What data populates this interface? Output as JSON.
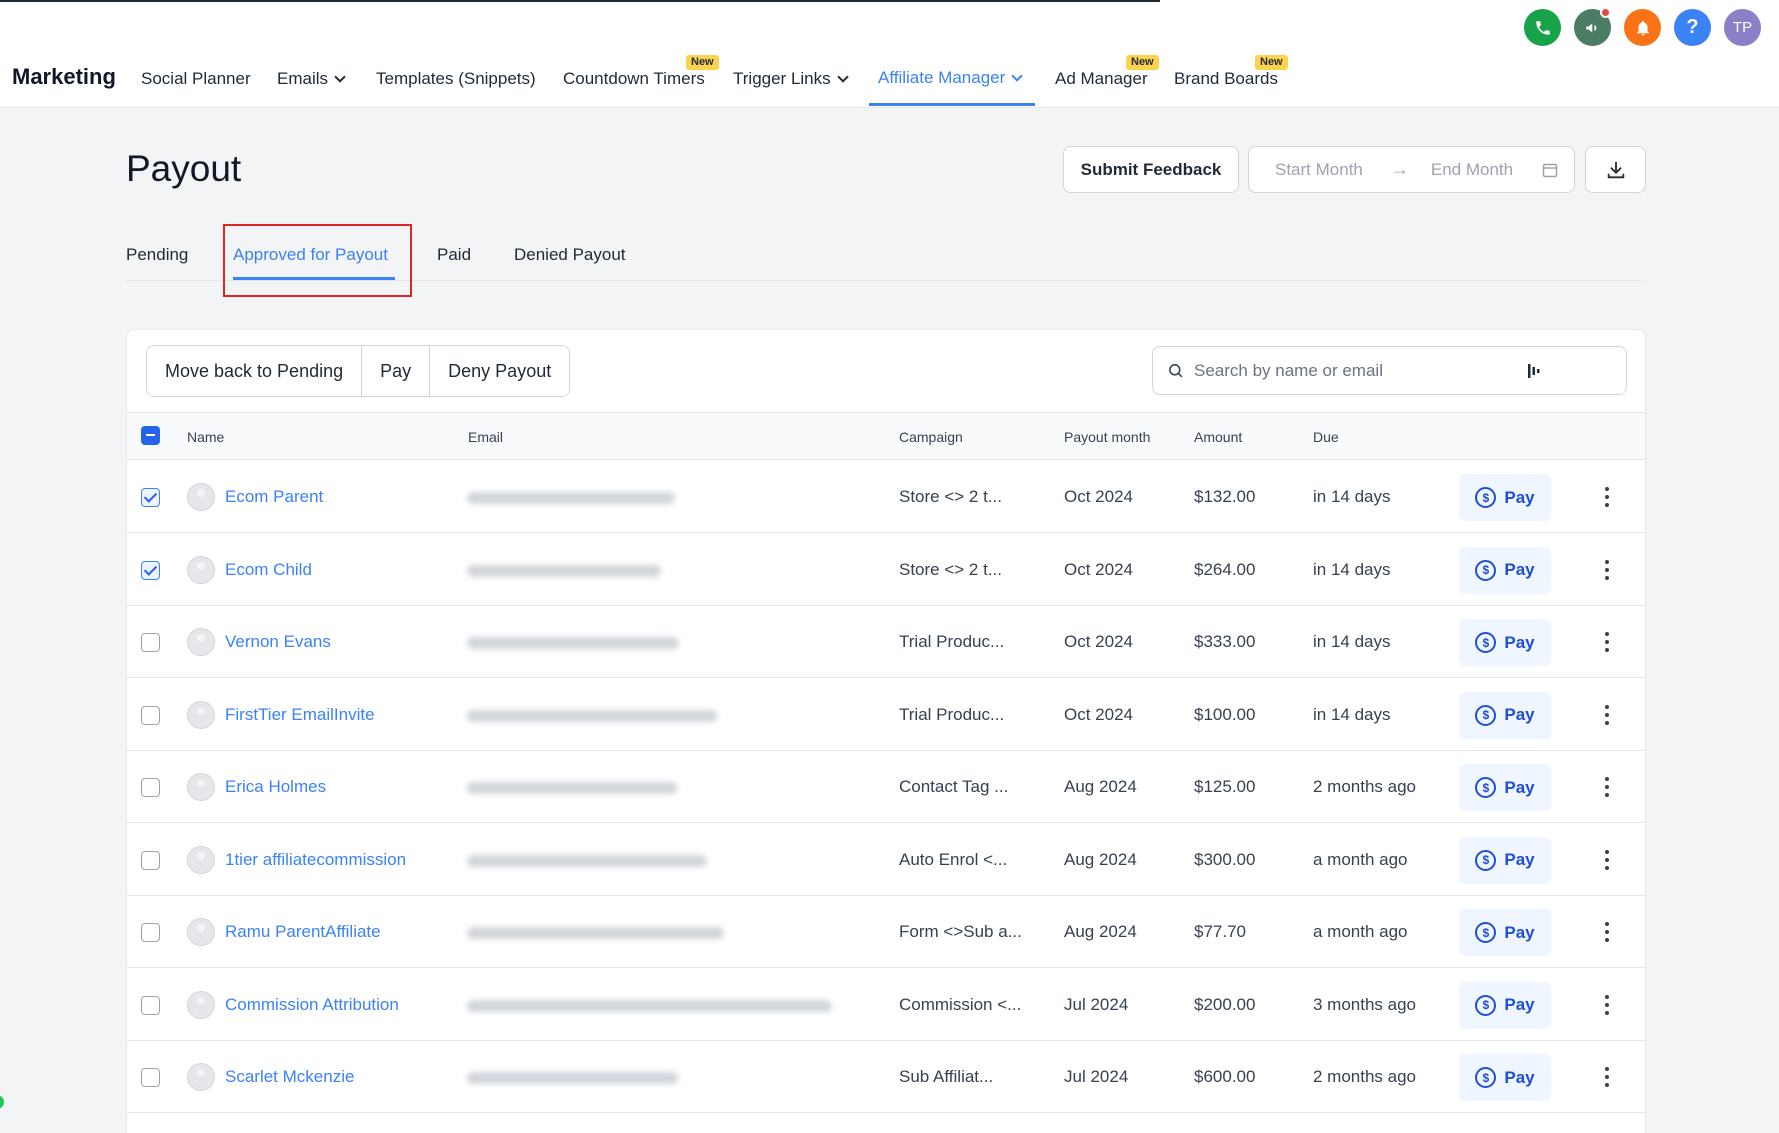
{
  "header": {
    "brand": "Marketing",
    "nav": [
      {
        "label": "Social Planner",
        "dropdown": false,
        "badge": ""
      },
      {
        "label": "Emails",
        "dropdown": true,
        "badge": ""
      },
      {
        "label": "Templates (Snippets)",
        "dropdown": false,
        "badge": ""
      },
      {
        "label": "Countdown Timers",
        "dropdown": false,
        "badge": "New"
      },
      {
        "label": "Trigger Links",
        "dropdown": true,
        "badge": ""
      },
      {
        "label": "Affiliate Manager",
        "dropdown": true,
        "badge": "",
        "active": true
      },
      {
        "label": "Ad Manager",
        "dropdown": false,
        "badge": "New"
      },
      {
        "label": "Brand Boards",
        "dropdown": false,
        "badge": "New"
      }
    ],
    "icons": {
      "phone": {
        "name": "phone-icon",
        "color": "#16a34a"
      },
      "announce": {
        "name": "megaphone-icon",
        "color": "#4a7c66"
      },
      "bell": {
        "name": "bell-icon",
        "color": "#f97316"
      },
      "help": {
        "name": "help-icon",
        "color": "#3b82f6",
        "glyph": "?"
      },
      "user": {
        "initials": "TP",
        "color": "#8b7fc7"
      }
    }
  },
  "page": {
    "title": "Payout",
    "submit_feedback": "Submit Feedback",
    "start_month": "Start Month",
    "end_month": "End Month"
  },
  "tabs": [
    "Pending",
    "Approved for Payout",
    "Paid",
    "Denied Payout"
  ],
  "toolbar": {
    "actions": [
      "Move back to Pending",
      "Pay",
      "Deny Payout"
    ],
    "search_placeholder": "Search by name or email"
  },
  "table": {
    "columns": {
      "name": "Name",
      "email": "Email",
      "campaign": "Campaign",
      "payout_month": "Payout month",
      "amount": "Amount",
      "due": "Due"
    },
    "pay_label": "Pay",
    "rows": [
      {
        "name": "Ecom Parent",
        "campaign": "Store <> 2 t...",
        "month": "Oct 2024",
        "amount": "$132.00",
        "due": "in 14 days",
        "checked": true
      },
      {
        "name": "Ecom Child",
        "campaign": "Store <> 2 t...",
        "month": "Oct 2024",
        "amount": "$264.00",
        "due": "in 14 days",
        "checked": true
      },
      {
        "name": "Vernon Evans",
        "campaign": "Trial Produc...",
        "month": "Oct 2024",
        "amount": "$333.00",
        "due": "in 14 days",
        "checked": false
      },
      {
        "name": "FirstTier EmailInvite",
        "campaign": "Trial Produc...",
        "month": "Oct 2024",
        "amount": "$100.00",
        "due": "in 14 days",
        "checked": false
      },
      {
        "name": "Erica Holmes",
        "campaign": "Contact Tag ...",
        "month": "Aug 2024",
        "amount": "$125.00",
        "due": "2 months ago",
        "checked": false
      },
      {
        "name": "1tier affiliatecommission",
        "campaign": "Auto Enrol <...",
        "month": "Aug 2024",
        "amount": "$300.00",
        "due": "a month ago",
        "checked": false
      },
      {
        "name": "Ramu ParentAffiliate",
        "campaign": "Form <>Sub a...",
        "month": "Aug 2024",
        "amount": "$77.70",
        "due": "a month ago",
        "checked": false
      },
      {
        "name": "Commission Attribution",
        "campaign": "Commission <...",
        "month": "Jul 2024",
        "amount": "$200.00",
        "due": "3 months ago",
        "checked": false
      },
      {
        "name": "Scarlet Mckenzie",
        "campaign": "Sub Affiliat...",
        "month": "Jul 2024",
        "amount": "$600.00",
        "due": "2 months ago",
        "checked": false
      }
    ]
  }
}
